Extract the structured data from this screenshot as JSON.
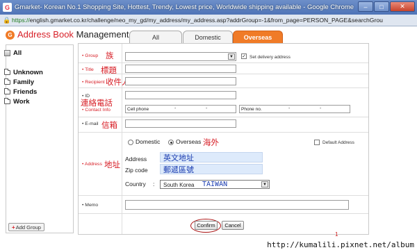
{
  "window": {
    "title": "Gmarket- Korean No.1 Shopping Site, Hottest, Trendy, Lowest price, Worldwide shipping available - Google Chrome",
    "buttons": [
      "–",
      "□",
      "✕"
    ]
  },
  "urlbar": {
    "scheme": "https://",
    "url_rest": "english.gmarket.co.kr/challenge/neo_my_gd/my_address/my_address.asp?addrGroup=-1&from_page=PERSON_PAGE&searchGrou"
  },
  "header": {
    "logo_letter": "G",
    "title_red": "Address Book",
    "title_black": "Management",
    "tabs": [
      {
        "label": "All"
      },
      {
        "label": "Domestic"
      },
      {
        "label": "Overseas",
        "active": true
      }
    ]
  },
  "sidebar": {
    "all_label": "All",
    "items": [
      {
        "label": "Unknown"
      },
      {
        "label": "Family"
      },
      {
        "label": "Friends"
      },
      {
        "label": "Work"
      }
    ],
    "add_group_label": "Add Group"
  },
  "form": {
    "group_label": "Group",
    "group_note": "族",
    "set_delivery_label": "Set delivery address",
    "title_label": "Title",
    "title_note": "標題",
    "recipient_label": "Recipient",
    "recipient_note": "收件人",
    "id_label": "ID",
    "contact_label": "Contact Info",
    "contact_note": "連絡電話",
    "cellphone_label": "Cell phone",
    "phone_label": "Phone no.",
    "dash": "-",
    "email_label": "E-mail",
    "email_note": "信箱",
    "address_label": "Address",
    "address_note": "地址",
    "radio_domestic": "Domestic",
    "radio_overseas": "Overseas",
    "radio_overseas_note": "海外",
    "default_address_label": "Default Address",
    "addr_field_label": "Address",
    "addr_field_value": "英文地址",
    "zip_label": "Zip code",
    "zip_value": "郵遞區號",
    "country_label": "Country",
    "country_value": "South Korea",
    "country_note": "TAIWAN",
    "memo_label": "Memo",
    "confirm_label": "Confirm",
    "cancel_label": "Cancel"
  },
  "watermark": "http://kumalili.pixnet.net/album",
  "annotation_mark": "1",
  "colors": {
    "accent": "#d71e26",
    "tab_active": "#f07b27",
    "handwritten_blue": "#1a3cb0"
  }
}
